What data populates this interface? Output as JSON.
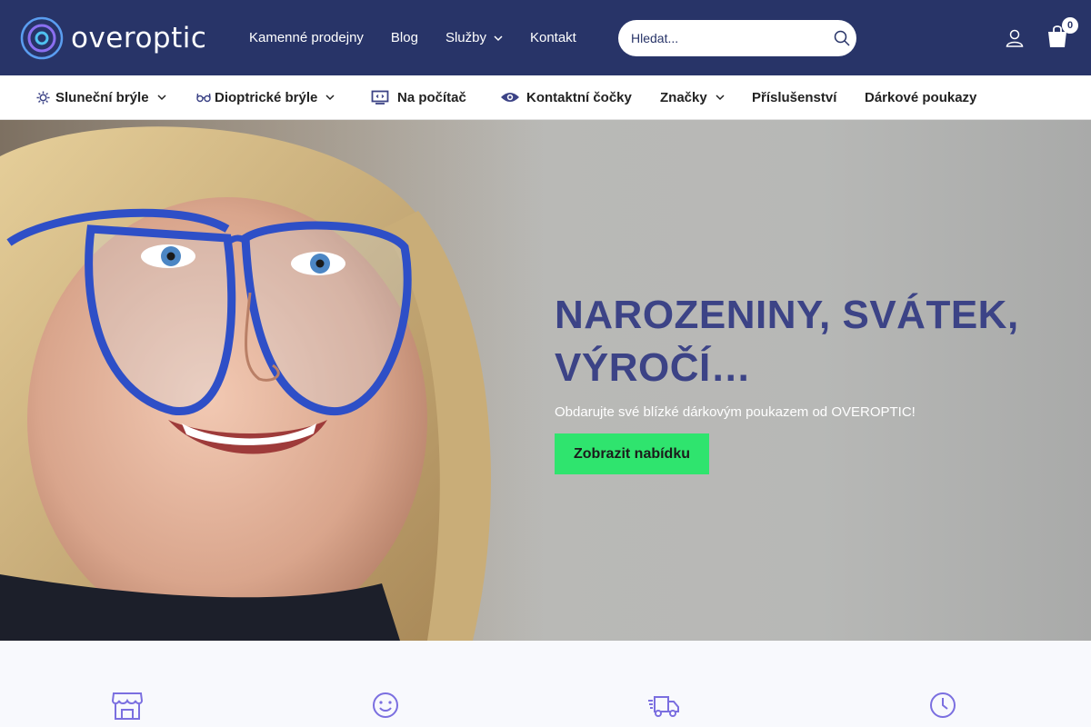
{
  "header": {
    "logo_text": "overoptic",
    "nav": [
      {
        "label": "Kamenné prodejny"
      },
      {
        "label": "Blog"
      },
      {
        "label": "Služby"
      },
      {
        "label": "Kontakt"
      }
    ],
    "search_placeholder": "Hledat...",
    "cart_count": "0"
  },
  "categories": [
    {
      "label": "Sluneční brýle",
      "icon": "sun-icon"
    },
    {
      "label": "Dioptrické brýle",
      "icon": "glasses-icon"
    },
    {
      "label": "Na počítač",
      "icon": "monitor-icon"
    },
    {
      "label": "Kontaktní čočky",
      "icon": "eye-icon"
    },
    {
      "label": "Značky"
    },
    {
      "label": "Příslušenství"
    },
    {
      "label": "Dárkové poukazy"
    }
  ],
  "hero": {
    "title": "NAROZENINY, SVÁTEK, VÝROČÍ…",
    "subtitle": "Obdarujte své blízké dárkovým poukazem od OVEROPTIC!",
    "button": "Zobrazit nabídku"
  },
  "features": [
    {
      "icon": "store-icon"
    },
    {
      "icon": "smile-icon"
    },
    {
      "icon": "delivery-truck-icon"
    },
    {
      "icon": "clock-icon"
    }
  ],
  "colors": {
    "header_bg": "#283468",
    "accent_green": "#2fe46e",
    "hero_title": "#3c4386",
    "icon_purple": "#7b6fe0"
  }
}
